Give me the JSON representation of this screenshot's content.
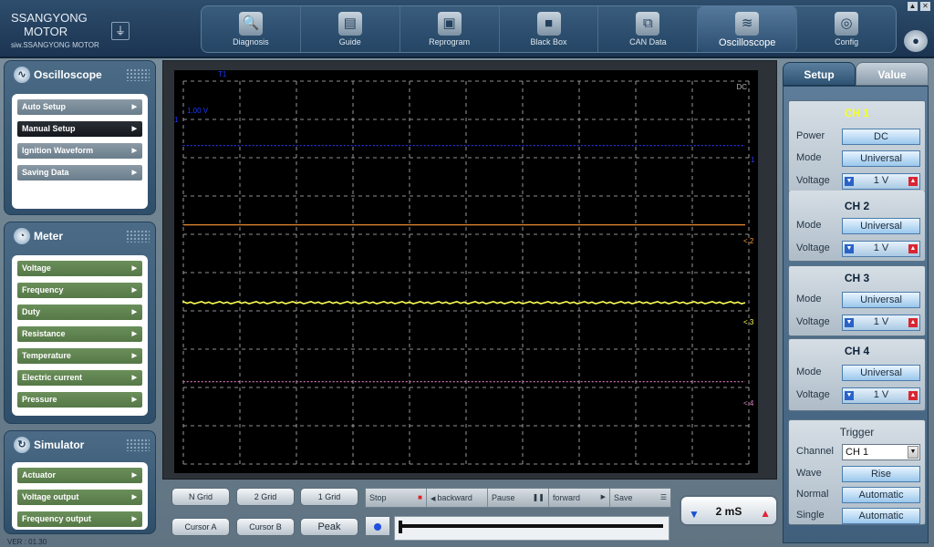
{
  "brand": {
    "line1": "SSANGYONG",
    "line2": "MOTOR",
    "line3": "siw.SSANGYONG MOTOR"
  },
  "window": {
    "minimize": "▲",
    "close": "✕"
  },
  "nav": [
    {
      "label": "Diagnosis",
      "icon": "🔍"
    },
    {
      "label": "Guide",
      "icon": "▤"
    },
    {
      "label": "Reprogram",
      "icon": "▣"
    },
    {
      "label": "Black Box",
      "icon": "■"
    },
    {
      "label": "CAN Data",
      "icon": "⧉"
    },
    {
      "label": "Oscilloscope",
      "icon": "≋"
    },
    {
      "label": "Config",
      "icon": "◎"
    }
  ],
  "panels": {
    "oscilloscope": {
      "title": "Oscilloscope",
      "items": [
        "Auto Setup",
        "Manual Setup",
        "Ignition Waveform",
        "Saving Data"
      ],
      "selected": "Manual Setup"
    },
    "meter": {
      "title": "Meter",
      "items": [
        "Voltage",
        "Frequency",
        "Duty",
        "Resistance",
        "Temperature",
        "Electric current",
        "Pressure"
      ]
    },
    "simulator": {
      "title": "Simulator",
      "items": [
        "Actuator",
        "Voltage output",
        "Frequency output"
      ]
    }
  },
  "version": "VER : 01.30",
  "scope": {
    "coupling": "DC",
    "volt_label": "1.00 V",
    "top_marker": "T1",
    "left_marker": "1",
    "channels": [
      {
        "name": "1",
        "marker": "1",
        "color": "#2a3cff"
      },
      {
        "name": "2",
        "marker": "< 2",
        "color": "#ff9a3a"
      },
      {
        "name": "3",
        "marker": "< 3",
        "color": "#ffff55"
      },
      {
        "name": "4",
        "marker": "< 4",
        "color": "#e080c8"
      }
    ]
  },
  "buttons": {
    "n_grid": "N Grid",
    "two_grid": "2 Grid",
    "one_grid": "1 Grid",
    "cursor_a": "Cursor A",
    "cursor_b": "Cursor B",
    "peak": "Peak"
  },
  "transport": {
    "stop": "Stop",
    "backward": "backward",
    "pause": "Pause",
    "forward": "forward",
    "save": "Save"
  },
  "time": {
    "value": "2 mS"
  },
  "right": {
    "tabs": [
      "Setup",
      "Value"
    ],
    "ch1": {
      "title": "CH 1",
      "power_label": "Power",
      "power": "DC",
      "mode_label": "Mode",
      "mode": "Universal",
      "voltage_label": "Voltage",
      "voltage": "1 V"
    },
    "ch2": {
      "title": "CH 2",
      "mode_label": "Mode",
      "mode": "Universal",
      "voltage_label": "Voltage",
      "voltage": "1 V"
    },
    "ch3": {
      "title": "CH 3",
      "mode_label": "Mode",
      "mode": "Universal",
      "voltage_label": "Voltage",
      "voltage": "1 V"
    },
    "ch4": {
      "title": "CH 4",
      "mode_label": "Mode",
      "mode": "Universal",
      "voltage_label": "Voltage",
      "voltage": "1 V"
    },
    "trigger": {
      "title": "Trigger",
      "channel_label": "Channel",
      "channel": "CH 1",
      "wave_label": "Wave",
      "wave": "Rise",
      "normal_label": "Normal",
      "normal": "Automatic",
      "single_label": "Single",
      "single": "Automatic"
    }
  },
  "colors": {
    "accent": "#2e5272",
    "scope_bg": "#000000",
    "grid": "#bfbfbf"
  }
}
